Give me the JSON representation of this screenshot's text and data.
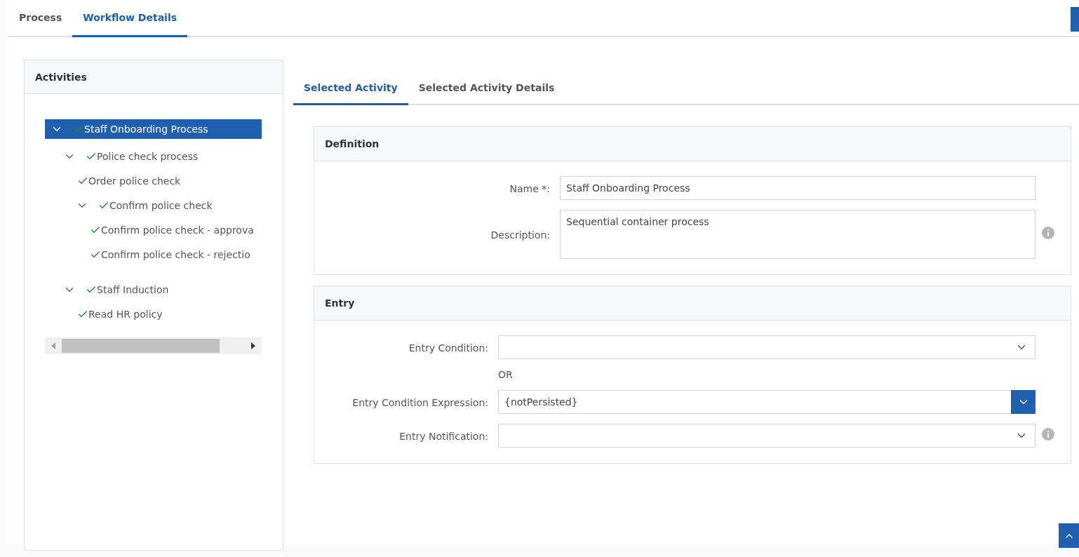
{
  "tabs": [
    {
      "label": "Process",
      "selected": false
    },
    {
      "label": "Workflow Details",
      "selected": true
    }
  ],
  "activities": {
    "title": "Activities",
    "tree": [
      {
        "label": "Staff Onboarding Process",
        "selected": true,
        "expanded": true,
        "children": [
          {
            "label": "Police check process",
            "selected": false,
            "expanded": true,
            "children": [
              {
                "label": "Order police check",
                "selected": false
              },
              {
                "label": "Confirm police check",
                "selected": false,
                "expanded": true,
                "children": [
                  {
                    "label": "Confirm police check - approva",
                    "selected": false
                  },
                  {
                    "label": "Confirm police check - rejectio",
                    "selected": false
                  }
                ]
              }
            ]
          },
          {
            "label": "Staff Induction",
            "selected": false,
            "expanded": true,
            "children": [
              {
                "label": "Read HR policy",
                "selected": false
              }
            ]
          }
        ]
      }
    ]
  },
  "detail_tabs": [
    {
      "label": "Selected Activity",
      "selected": true
    },
    {
      "label": "Selected Activity Details",
      "selected": false
    }
  ],
  "definition": {
    "title": "Definition",
    "fields": [
      {
        "kind": "text",
        "label": "Name *:",
        "value": "Staff Onboarding Process"
      },
      {
        "kind": "textarea",
        "label": "Description:",
        "value": "Sequential container process",
        "info": true
      }
    ]
  },
  "entry": {
    "title": "Entry",
    "fields": [
      {
        "kind": "select",
        "label": "Entry Condition:"
      },
      {
        "kind": "separator",
        "label": "OR"
      },
      {
        "kind": "combo",
        "label": "Entry Condition Expression:",
        "value": "{notPersisted}"
      },
      {
        "kind": "select",
        "label": "Entry Notification:",
        "info": true
      }
    ]
  }
}
